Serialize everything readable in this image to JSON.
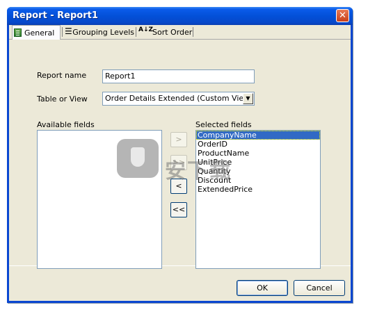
{
  "window": {
    "title": "Report - Report1",
    "close_glyph": "✕"
  },
  "tabs": [
    {
      "label": "General",
      "icon": "general-icon"
    },
    {
      "label": "Grouping Levels",
      "icon": "grouping-icon"
    },
    {
      "label": "Sort Order",
      "icon": "sort-az-icon",
      "glyph": "A↓Z"
    }
  ],
  "form": {
    "report_name_label": "Report name",
    "report_name_value": "Report1",
    "table_label": "Table or View",
    "table_value": "Order Details Extended (Custom View)",
    "available_label": "Available fields",
    "selected_label": "Selected fields",
    "selected_fields": [
      "CompanyName",
      "OrderID",
      "ProductName",
      "UnitPrice",
      "Quantity",
      "Discount",
      "ExtendedPrice"
    ]
  },
  "move_buttons": {
    "add": ">",
    "add_all": ">>",
    "remove": "<",
    "remove_all": "<<"
  },
  "watermark": {
    "text": "安下载"
  },
  "footer": {
    "ok": "OK",
    "cancel": "Cancel"
  }
}
